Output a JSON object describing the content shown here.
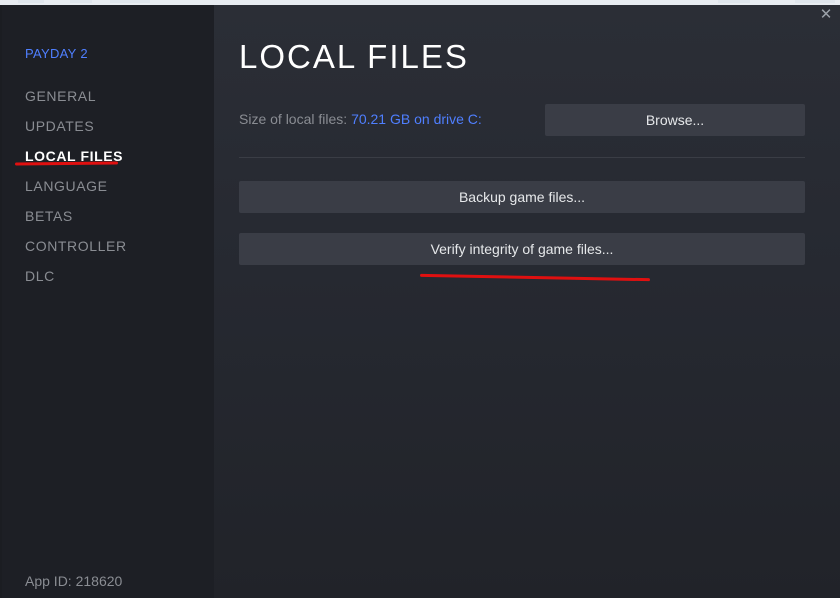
{
  "sidebar": {
    "game_title": "PAYDAY 2",
    "items": [
      {
        "label": "GENERAL",
        "active": false
      },
      {
        "label": "UPDATES",
        "active": false
      },
      {
        "label": "LOCAL FILES",
        "active": true
      },
      {
        "label": "LANGUAGE",
        "active": false
      },
      {
        "label": "BETAS",
        "active": false
      },
      {
        "label": "CONTROLLER",
        "active": false
      },
      {
        "label": "DLC",
        "active": false
      }
    ],
    "app_id": "App ID: 218620"
  },
  "main": {
    "title": "LOCAL FILES",
    "size_label": "Size of local files: ",
    "size_value": "70.21 GB on drive C:",
    "browse_label": "Browse...",
    "backup_label": "Backup game files...",
    "verify_label": "Verify integrity of game files..."
  },
  "window": {
    "close_icon": "close-icon"
  },
  "colors": {
    "accent": "#4f7fff",
    "annotation": "#e01010",
    "sidebar_bg": "#1d1f25",
    "button_bg": "#3a3d46"
  }
}
